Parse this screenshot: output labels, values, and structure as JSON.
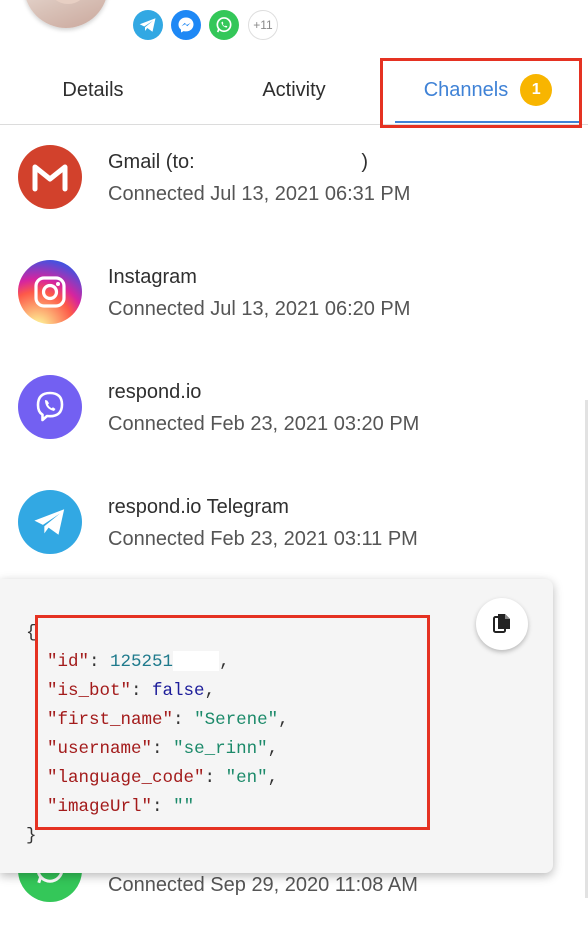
{
  "header": {
    "more_channels": "+11",
    "icons": [
      "telegram-icon",
      "messenger-icon",
      "whatsapp-icon"
    ]
  },
  "tabs": [
    {
      "label": "Details",
      "active": false
    },
    {
      "label": "Activity",
      "active": false
    },
    {
      "label": "Channels",
      "active": true,
      "badge": "1"
    }
  ],
  "channels": [
    {
      "name": "Gmail (to:                              )",
      "time": "Connected Jul 13, 2021 06:31 PM",
      "icon": "gmail-icon",
      "color": "#d2412c"
    },
    {
      "name": "Instagram",
      "time": "Connected Jul 13, 2021 06:20 PM",
      "icon": "instagram-icon",
      "color": "#e1306c"
    },
    {
      "name": "respond.io",
      "time": "Connected Feb 23, 2021 03:20 PM",
      "icon": "viber-icon",
      "color": "#7360f2"
    },
    {
      "name": "respond.io Telegram",
      "time": "Connected Feb 23, 2021 03:11 PM",
      "icon": "telegram-icon",
      "color": "#32a8e3"
    },
    {
      "name": "",
      "time": "Connected Sep 29, 2020 11:08 AM",
      "icon": "whatsapp-icon",
      "color": "#34c759"
    }
  ],
  "popup": {
    "open_brace": "{",
    "close_brace": "}",
    "fields": {
      "id_key": "\"id\"",
      "id_value": "125251",
      "is_bot_key": "\"is_bot\"",
      "is_bot_value": "false",
      "first_name_key": "\"first_name\"",
      "first_name_value": "\"Serene\"",
      "username_key": "\"username\"",
      "username_value": "\"se_rinn\"",
      "language_code_key": "\"language_code\"",
      "language_code_value": "\"en\"",
      "imageUrl_key": "\"imageUrl\"",
      "imageUrl_value": "\"\""
    },
    "copy_icon": "copy-icon"
  },
  "colors": {
    "accent": "#3f82d6",
    "badge": "#f8b500",
    "highlight": "#e53222"
  }
}
